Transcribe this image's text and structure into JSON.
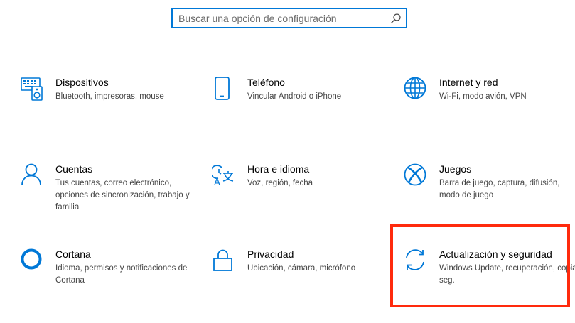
{
  "search": {
    "placeholder": "Buscar una opción de configuración"
  },
  "tiles": [
    {
      "title": "Dispositivos",
      "desc": "Bluetooth, impresoras, mouse",
      "icon": "devices-icon"
    },
    {
      "title": "Teléfono",
      "desc": "Vincular Android o iPhone",
      "icon": "phone-icon"
    },
    {
      "title": "Internet y red",
      "desc": "Wi-Fi, modo avión, VPN",
      "icon": "globe-icon"
    },
    {
      "title": "Cuentas",
      "desc": "Tus cuentas, correo electrónico, opciones de sincronización, trabajo y familia",
      "icon": "person-icon"
    },
    {
      "title": "Hora e idioma",
      "desc": "Voz, región, fecha",
      "icon": "time-language-icon"
    },
    {
      "title": "Juegos",
      "desc": "Barra de juego, captura, difusión, modo de juego",
      "icon": "xbox-icon"
    },
    {
      "title": "Cortana",
      "desc": "Idioma, permisos y notificaciones de Cortana",
      "icon": "cortana-icon"
    },
    {
      "title": "Privacidad",
      "desc": "Ubicación, cámara, micrófono",
      "icon": "lock-icon"
    },
    {
      "title": "Actualización y seguridad",
      "desc": "Windows Update, recuperación, copia seg.",
      "icon": "sync-icon"
    }
  ],
  "colors": {
    "accent": "#0078d7",
    "highlight": "#ff2a0d"
  }
}
